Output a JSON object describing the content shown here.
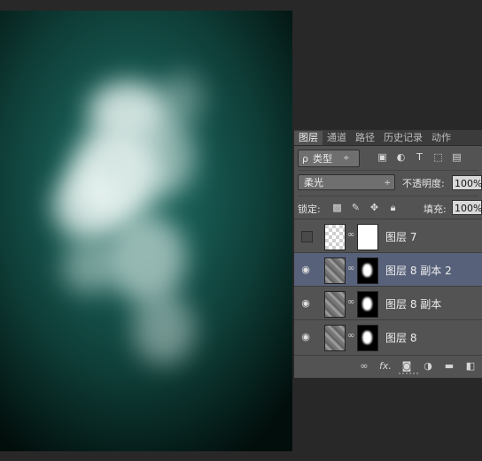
{
  "tabs": [
    "图层",
    "通道",
    "路径",
    "历史记录",
    "动作"
  ],
  "filter": {
    "label": "类型",
    "prefix": "ρ",
    "arrow": "÷"
  },
  "filter_icons": [
    "image-filter-icon",
    "adjustment-filter-icon",
    "text-filter-icon",
    "shape-filter-icon",
    "smart-object-filter-icon"
  ],
  "blend_mode": {
    "value": "柔光",
    "arrow": "÷"
  },
  "opacity": {
    "label": "不透明度:",
    "value": "100%"
  },
  "lock": {
    "label": "锁定:"
  },
  "fill": {
    "label": "填充:",
    "value": "100%"
  },
  "layers": [
    {
      "name": "图层 7",
      "visible": false,
      "selected": false
    },
    {
      "name": "图层 8 副本 2",
      "visible": true,
      "selected": true
    },
    {
      "name": "图层 8 副本",
      "visible": true,
      "selected": false
    },
    {
      "name": "图层 8",
      "visible": true,
      "selected": false
    }
  ],
  "bottom_icons": [
    "link-layers-icon",
    "fx-icon",
    "add-mask-icon",
    "adjustment-layer-icon",
    "new-group-icon",
    "new-layer-icon"
  ],
  "bottom_fx": "fx.",
  "colors": {
    "panel_bg": "#535353",
    "selected_row": "#58617a",
    "canvas_teal": "#1f6a60"
  }
}
